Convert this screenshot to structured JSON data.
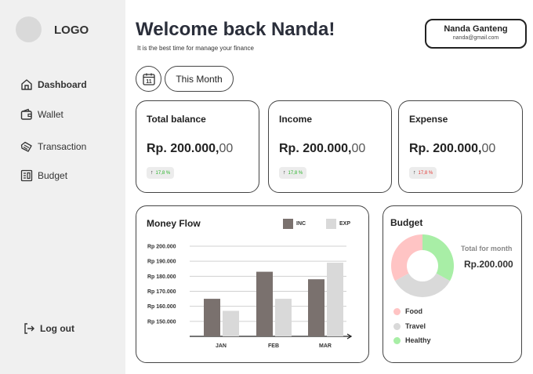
{
  "sidebar": {
    "logo": "LOGO",
    "items": [
      {
        "label": "Dashboard",
        "icon": "home-icon"
      },
      {
        "label": "Wallet",
        "icon": "wallet-icon"
      },
      {
        "label": "Transaction",
        "icon": "transaction-icon"
      },
      {
        "label": "Budget",
        "icon": "budget-icon"
      }
    ],
    "logout": "Log out"
  },
  "header": {
    "title": "Welcome back Nanda!",
    "subtitle": "It is the best time for manage your finance"
  },
  "profile": {
    "name": "Nanda Ganteng",
    "email": "nanda@gmail.com"
  },
  "filter": {
    "calendar_day": "11",
    "period": "This Month"
  },
  "cards": [
    {
      "title": "Total balance",
      "amount": "Rp. 200.000,",
      "cents": "00",
      "change": "17,8 %",
      "color": "#2bb52b"
    },
    {
      "title": "Income",
      "amount": "Rp. 200.000,",
      "cents": "00",
      "change": "17,8 %",
      "color": "#2bb52b"
    },
    {
      "title": "Expense",
      "amount": "Rp. 200.000,",
      "cents": "00",
      "change": "17,8 %",
      "color": "#e53935"
    }
  ],
  "money_flow": {
    "title": "Money Flow",
    "legend_inc": "INC",
    "legend_exp": "EXP",
    "inc_color": "#7a716e",
    "exp_color": "#d9d9d9"
  },
  "chart_data": {
    "type": "bar",
    "categories": [
      "JAN",
      "FEB",
      "MAR"
    ],
    "series": [
      {
        "name": "INC",
        "values": [
          165000,
          183000,
          178000
        ]
      },
      {
        "name": "EXP",
        "values": [
          157000,
          165000,
          189000
        ]
      }
    ],
    "yticks": [
      "Rp 200.000",
      "Rp 190.000",
      "Rp 180.000",
      "Rp 170.000",
      "Rp 160.000",
      "Rp 150.000"
    ],
    "ylim": [
      140000,
      200000
    ],
    "grid": true
  },
  "budget": {
    "title": "Budget",
    "total_label": "Total for month",
    "total_value": "Rp.200.000",
    "categories": [
      {
        "label": "Food",
        "color": "#ffc4c4",
        "share": 0.33
      },
      {
        "label": "Travel",
        "color": "#d9d9d9",
        "share": 0.34
      },
      {
        "label": "Healthy",
        "color": "#a8eea6",
        "share": 0.33
      }
    ]
  }
}
